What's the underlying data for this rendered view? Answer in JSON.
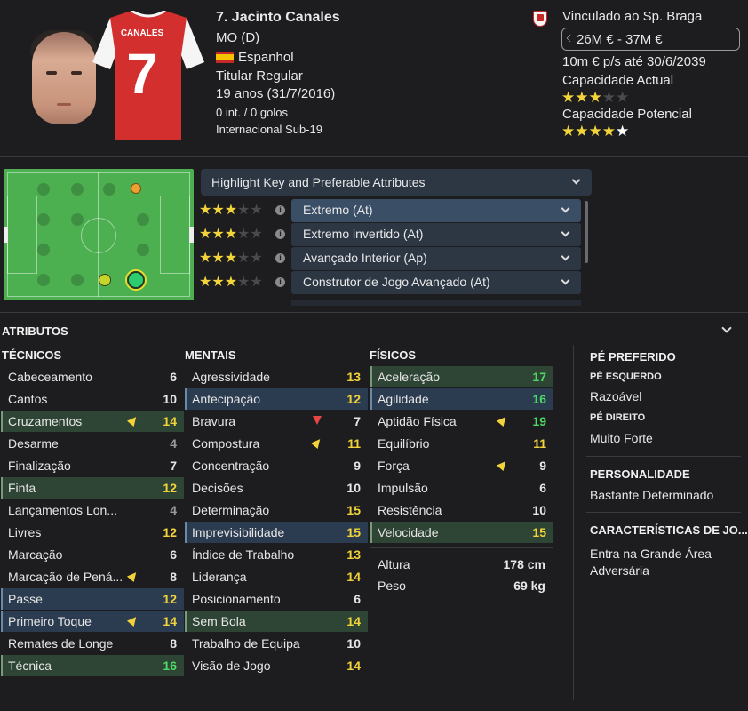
{
  "player": {
    "name": "7. Jacinto Canales",
    "position": "MO (D)",
    "nationality": "Espanhol",
    "squad_status": "Titular Regular",
    "age": "19 anos (31/7/2016)",
    "caps": "0 int. / 0 golos",
    "intl": "Internacional Sub-19",
    "shirt_name": "CANALES",
    "shirt_number": "7"
  },
  "contract": {
    "club": "Vinculado ao Sp. Braga",
    "value": "26M € - 37M €",
    "wage": "10m € p/s até 30/6/2039",
    "ca_label": "Capacidade Actual",
    "ca_stars": 3,
    "pa_label": "Capacidade Potencial",
    "pa_stars": 4.5
  },
  "roles": {
    "dropdown": "Highlight Key and Preferable Attributes",
    "items": [
      {
        "label": "Extremo (At)",
        "stars": 3,
        "selected": true
      },
      {
        "label": "Extremo invertido (At)",
        "stars": 3
      },
      {
        "label": "Avançado Interior (Ap)",
        "stars": 3
      },
      {
        "label": "Construtor de Jogo Avançado (At)",
        "stars": 3
      }
    ]
  },
  "attributes": {
    "title": "ATRIBUTOS",
    "technical": {
      "header": "TÉCNICOS",
      "items": [
        {
          "label": "Cabeceamento",
          "value": "6"
        },
        {
          "label": "Cantos",
          "value": "10"
        },
        {
          "label": "Cruzamentos",
          "value": "14",
          "hl": "g",
          "trend": "up"
        },
        {
          "label": "Desarme",
          "value": "4"
        },
        {
          "label": "Finalização",
          "value": "7"
        },
        {
          "label": "Finta",
          "value": "12",
          "hl": "g"
        },
        {
          "label": "Lançamentos Lon...",
          "value": "4"
        },
        {
          "label": "Livres",
          "value": "12"
        },
        {
          "label": "Marcação",
          "value": "6"
        },
        {
          "label": "Marcação de Pená...",
          "value": "8",
          "trend": "up"
        },
        {
          "label": "Passe",
          "value": "12",
          "hl": "b"
        },
        {
          "label": "Primeiro Toque",
          "value": "14",
          "hl": "b",
          "trend": "up"
        },
        {
          "label": "Remates de Longe",
          "value": "8"
        },
        {
          "label": "Técnica",
          "value": "16",
          "hl": "g"
        }
      ]
    },
    "mental": {
      "header": "MENTAIS",
      "items": [
        {
          "label": "Agressividade",
          "value": "13"
        },
        {
          "label": "Antecipação",
          "value": "12",
          "hl": "b"
        },
        {
          "label": "Bravura",
          "value": "7",
          "trend": "down"
        },
        {
          "label": "Compostura",
          "value": "11",
          "trend": "up"
        },
        {
          "label": "Concentração",
          "value": "9"
        },
        {
          "label": "Decisões",
          "value": "10"
        },
        {
          "label": "Determinação",
          "value": "15"
        },
        {
          "label": "Imprevisibilidade",
          "value": "15",
          "hl": "b"
        },
        {
          "label": "Índice de Trabalho",
          "value": "13"
        },
        {
          "label": "Liderança",
          "value": "14"
        },
        {
          "label": "Posicionamento",
          "value": "6"
        },
        {
          "label": "Sem Bola",
          "value": "14",
          "hl": "g"
        },
        {
          "label": "Trabalho de Equipa",
          "value": "10"
        },
        {
          "label": "Visão de Jogo",
          "value": "14"
        }
      ]
    },
    "physical": {
      "header": "FÍSICOS",
      "items": [
        {
          "label": "Aceleração",
          "value": "17",
          "hl": "g"
        },
        {
          "label": "Agilidade",
          "value": "16",
          "hl": "b"
        },
        {
          "label": "Aptidão Física",
          "value": "19",
          "trend": "up"
        },
        {
          "label": "Equilíbrio",
          "value": "11"
        },
        {
          "label": "Força",
          "value": "9",
          "trend": "up"
        },
        {
          "label": "Impulsão",
          "value": "6"
        },
        {
          "label": "Resistência",
          "value": "10"
        },
        {
          "label": "Velocidade",
          "value": "15",
          "hl": "g"
        }
      ],
      "height_label": "Altura",
      "height": "178 cm",
      "weight_label": "Peso",
      "weight": "69 kg"
    }
  },
  "side": {
    "foot_header": "PÉ PREFERIDO",
    "left_header": "PÉ ESQUERDO",
    "left_value": "Razoável",
    "right_header": "PÉ DIREITO",
    "right_value": "Muito Forte",
    "pers_header": "PERSONALIDADE",
    "pers_value": "Bastante Determinado",
    "traits_header": "CARACTERÍSTICAS DE JO...",
    "traits_value_1": "Entra na Grande Área",
    "traits_value_2": "Adversária"
  },
  "colors": {
    "high": "#4cd964",
    "mid": "#f2d43a",
    "low": "#e6e6e6",
    "accent": "#f2d43a"
  }
}
